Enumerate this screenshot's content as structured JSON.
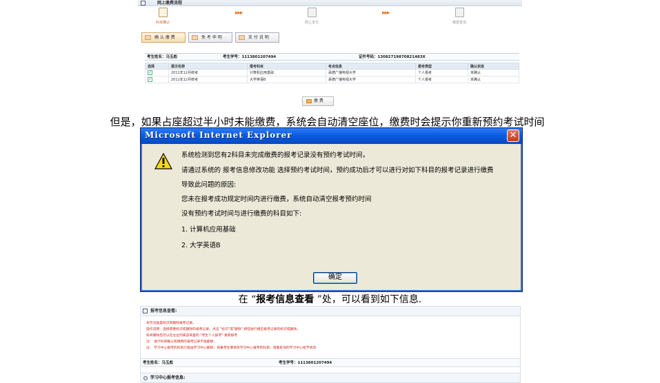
{
  "flow": {
    "title": "网上缴费流程",
    "steps": [
      "科目确认",
      "网上支付",
      "缴费查询"
    ],
    "arrows": "▸▸▸",
    "buttons": {
      "confirm": "确 认 缴 费",
      "exemption": "免 考 申 明",
      "payment_help": "支 付 说 明"
    },
    "student": {
      "name": "考生姓名：马玉彪",
      "number": "考生学号：1113801207494",
      "id_card": "证件号码：13082719870821483X"
    },
    "table": {
      "headers": [
        "选择",
        "报次名称",
        "报考科目",
        "考点信息",
        "报考类型",
        "确认状态"
      ],
      "rows": [
        [
          "✓",
          "2011年12月统考",
          "计算机应用基础",
          "承德广播电视大学",
          "个人报考",
          "未确认"
        ],
        [
          "✓",
          "2011年12月统考",
          "大学英语B",
          "承德广播电视大学",
          "个人报考",
          "未确认"
        ]
      ]
    },
    "pay_button": "缴 费"
  },
  "captions": {
    "first": "但是，如果占座超过半小时未能缴费，系统会自动清空座位，缴费时会提示你重新预约考试时间",
    "second_prefix": "在 “",
    "second_bold": "报考信息查看",
    "second_suffix": " ”处，可以看到如下信息."
  },
  "dialog": {
    "title": "Microsoft Internet Explorer",
    "close": "✕",
    "lines": [
      "系统检测到您有2科目未完成缴费的报考记录没有预约考试时间，",
      "请通过系统的 报考信息修改功能 选择预约考试时间，预约成功后才可以进行对如下科目的报考记录进行缴费",
      "导致此问题的原因:",
      "您未在报考成功规定时间内进行缴费，系统自动清空报考预约时间",
      "没有预约考试时间与进行缴费的科目如下:",
      "1. 计算机应用基础",
      "2. 大学英语B"
    ],
    "ok": "确定"
  },
  "info": {
    "title": "报考信息查看:",
    "notices": [
      "本页功能是标识和删除报考记录。",
      "操作说明：选择需要标识或删除的报考记录，点击 \"标识\"或\"删除\" 按钮进行相应报考记录的标识或删除。",
      "科目删除后可以在左边列表菜单里的 \"考生个人报考\" 重新报考",
      "注：  进行科目确认或缴费的报考记录不能删除；",
      "注：  学习中心报考的科目只能由学习中心删除，如果考生要修改学习中心报考的科目，请联系你的学习中心给予修改."
    ],
    "student_name": "考生姓名：马玉彪",
    "student_number": "考生学号：1113801207494",
    "center_title": "学习中心报考信息:"
  }
}
